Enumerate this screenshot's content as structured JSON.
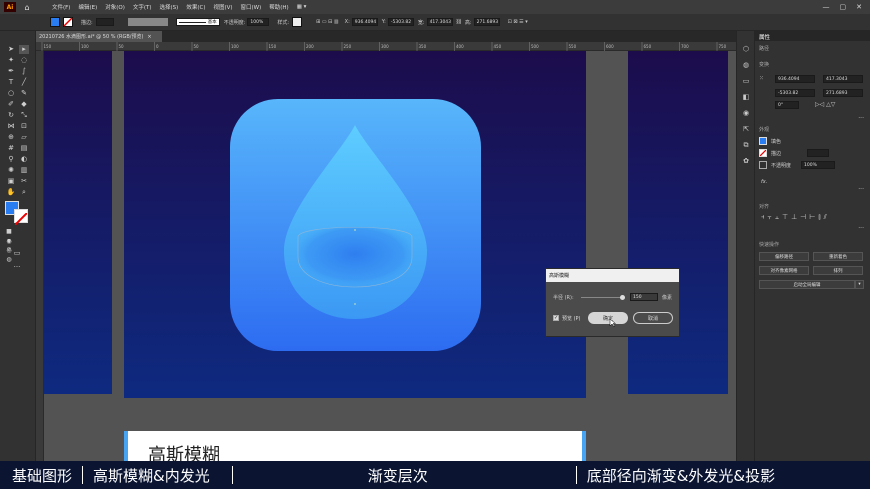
{
  "app": {
    "logo": "Ai",
    "home_icon": "home-icon"
  },
  "menu": [
    "文件(F)",
    "编辑(E)",
    "对象(O)",
    "文字(T)",
    "选择(S)",
    "效果(C)",
    "视图(V)",
    "窗口(W)",
    "帮助(H)"
  ],
  "window_controls": [
    "—",
    "▢",
    "✕"
  ],
  "control_bar": {
    "stroke_label": "描边:",
    "brush_label": "基本",
    "opacity_label": "不透明度:",
    "opacity_value": "100%",
    "style_label": "样式:",
    "x_label": "X:",
    "x_value": "936.4094",
    "y_label": "Y:",
    "y_value": "-5303.82",
    "w_label": "宽:",
    "w_value": "417.3043",
    "h_label": "高:",
    "h_value": "271.6893"
  },
  "document_tab": {
    "title": "20210726 水滴图形.ai* @ 50 % (RGB/预览)",
    "close": "×"
  },
  "ruler_ticks": [
    "150",
    "100",
    "50",
    "0",
    "50",
    "100",
    "150",
    "200",
    "250",
    "300",
    "350",
    "400",
    "450",
    "500",
    "550",
    "600",
    "650",
    "700",
    "750"
  ],
  "canvas": {
    "white_text": "高斯模糊",
    "colors": {
      "artboard_top": "#1c0c4c",
      "artboard_bottom": "#0e2a80",
      "icon_top": "#58b6fb",
      "icon_bottom": "#2d6cf1",
      "drop_top": "#57c6ff",
      "drop_bottom": "#3aa0f7"
    }
  },
  "dialog": {
    "title": "高斯模糊",
    "radius_label": "半径 (R):",
    "radius_value": "150",
    "radius_unit": "像素",
    "slider_fraction": 0.95,
    "preview_label": "预览 (P)",
    "preview_checked": true,
    "ok_label": "确定",
    "cancel_label": "取消"
  },
  "properties": {
    "tab": "属性",
    "object_type": "路径",
    "transform_title": "变换",
    "x_value": "936.4094",
    "y_value": "-5303.82",
    "w_value": "417.3043",
    "h_value": "271.6893",
    "angle_value": "0°",
    "appearance_title": "外观",
    "fill_label": "填色",
    "stroke_label": "描边",
    "opacity_label": "不透明度",
    "opacity_value": "100%",
    "fx_label": "fx.",
    "align_title": "对齐",
    "quick_actions_title": "快速操作",
    "btn_offset_path": "偏移路径",
    "btn_recolor": "重新着色",
    "btn_align_pixel": "对齐像素网格",
    "btn_arrange": "排列",
    "btn_global_edit": "启动全局编辑"
  },
  "subtitle_bar": {
    "item1": "基础图形",
    "item2": "高斯模糊&内发光",
    "item3": "渐变层次",
    "item4": "底部径向渐变&外发光&投影"
  }
}
